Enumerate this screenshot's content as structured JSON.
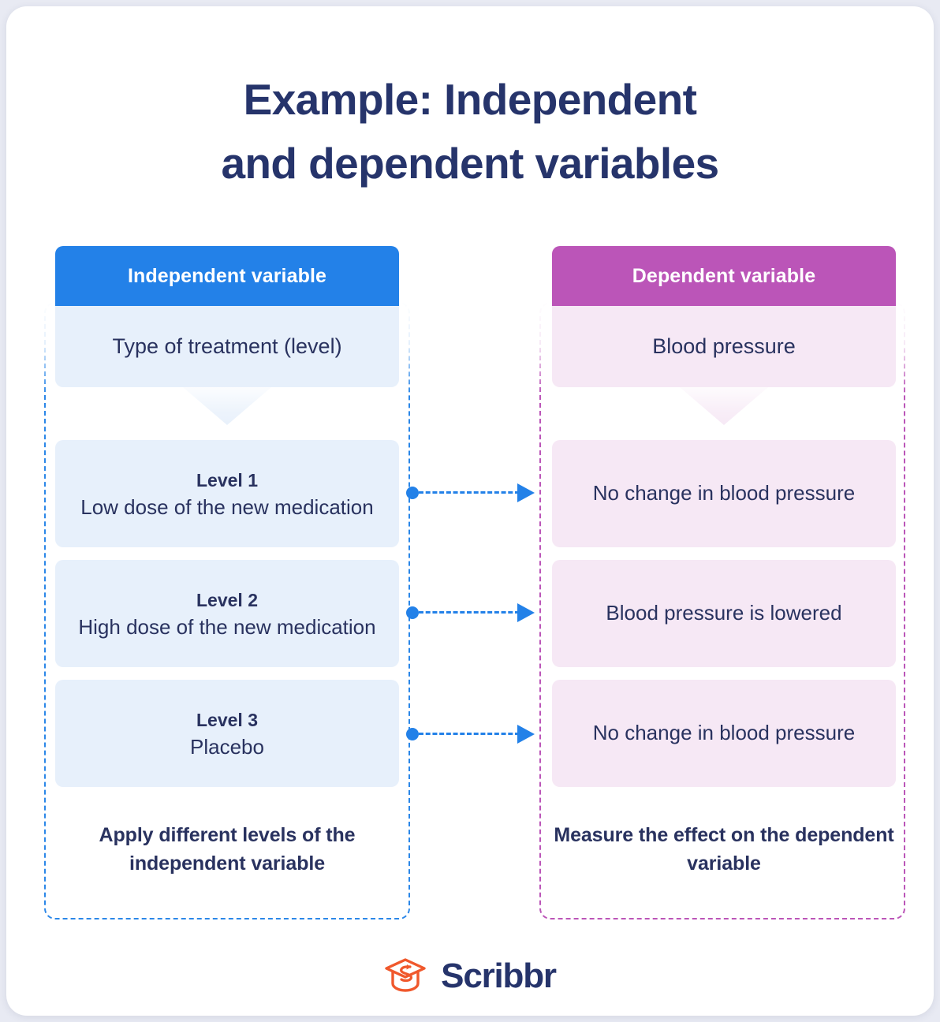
{
  "title": {
    "line1": "Example: Independent",
    "line2": "and dependent variables"
  },
  "colors": {
    "independent_accent": "#2381e8",
    "independent_fill": "#e7f0fb",
    "dependent_accent": "#bb55b8",
    "dependent_fill": "#f6e8f5",
    "text_navy": "#29325f",
    "title_navy": "#26346b",
    "logo_orange": "#f0582c",
    "page_background": "#e8eaf3"
  },
  "columns": {
    "independent": {
      "header": "Independent variable",
      "subject": "Type of treatment (level)",
      "footer": "Apply different levels of the independent variable",
      "items": [
        {
          "title": "Level 1",
          "text": "Low dose of the new medication"
        },
        {
          "title": "Level 2",
          "text": "High dose of the new medication"
        },
        {
          "title": "Level 3",
          "text": "Placebo"
        }
      ]
    },
    "dependent": {
      "header": "Dependent variable",
      "subject": "Blood pressure",
      "footer": "Measure the effect on the dependent variable",
      "items": [
        {
          "text": "No change in blood pressure"
        },
        {
          "text": "Blood pressure is lowered"
        },
        {
          "text": "No change in blood pressure"
        }
      ]
    }
  },
  "connectors": [
    {
      "from": "Level 1",
      "to": "No change in blood pressure"
    },
    {
      "from": "Level 2",
      "to": "Blood pressure is lowered"
    },
    {
      "from": "Level 3",
      "to": "No change in blood pressure"
    }
  ],
  "logo": {
    "wordmark": "Scribbr",
    "icon": "graduation-cap-icon"
  }
}
